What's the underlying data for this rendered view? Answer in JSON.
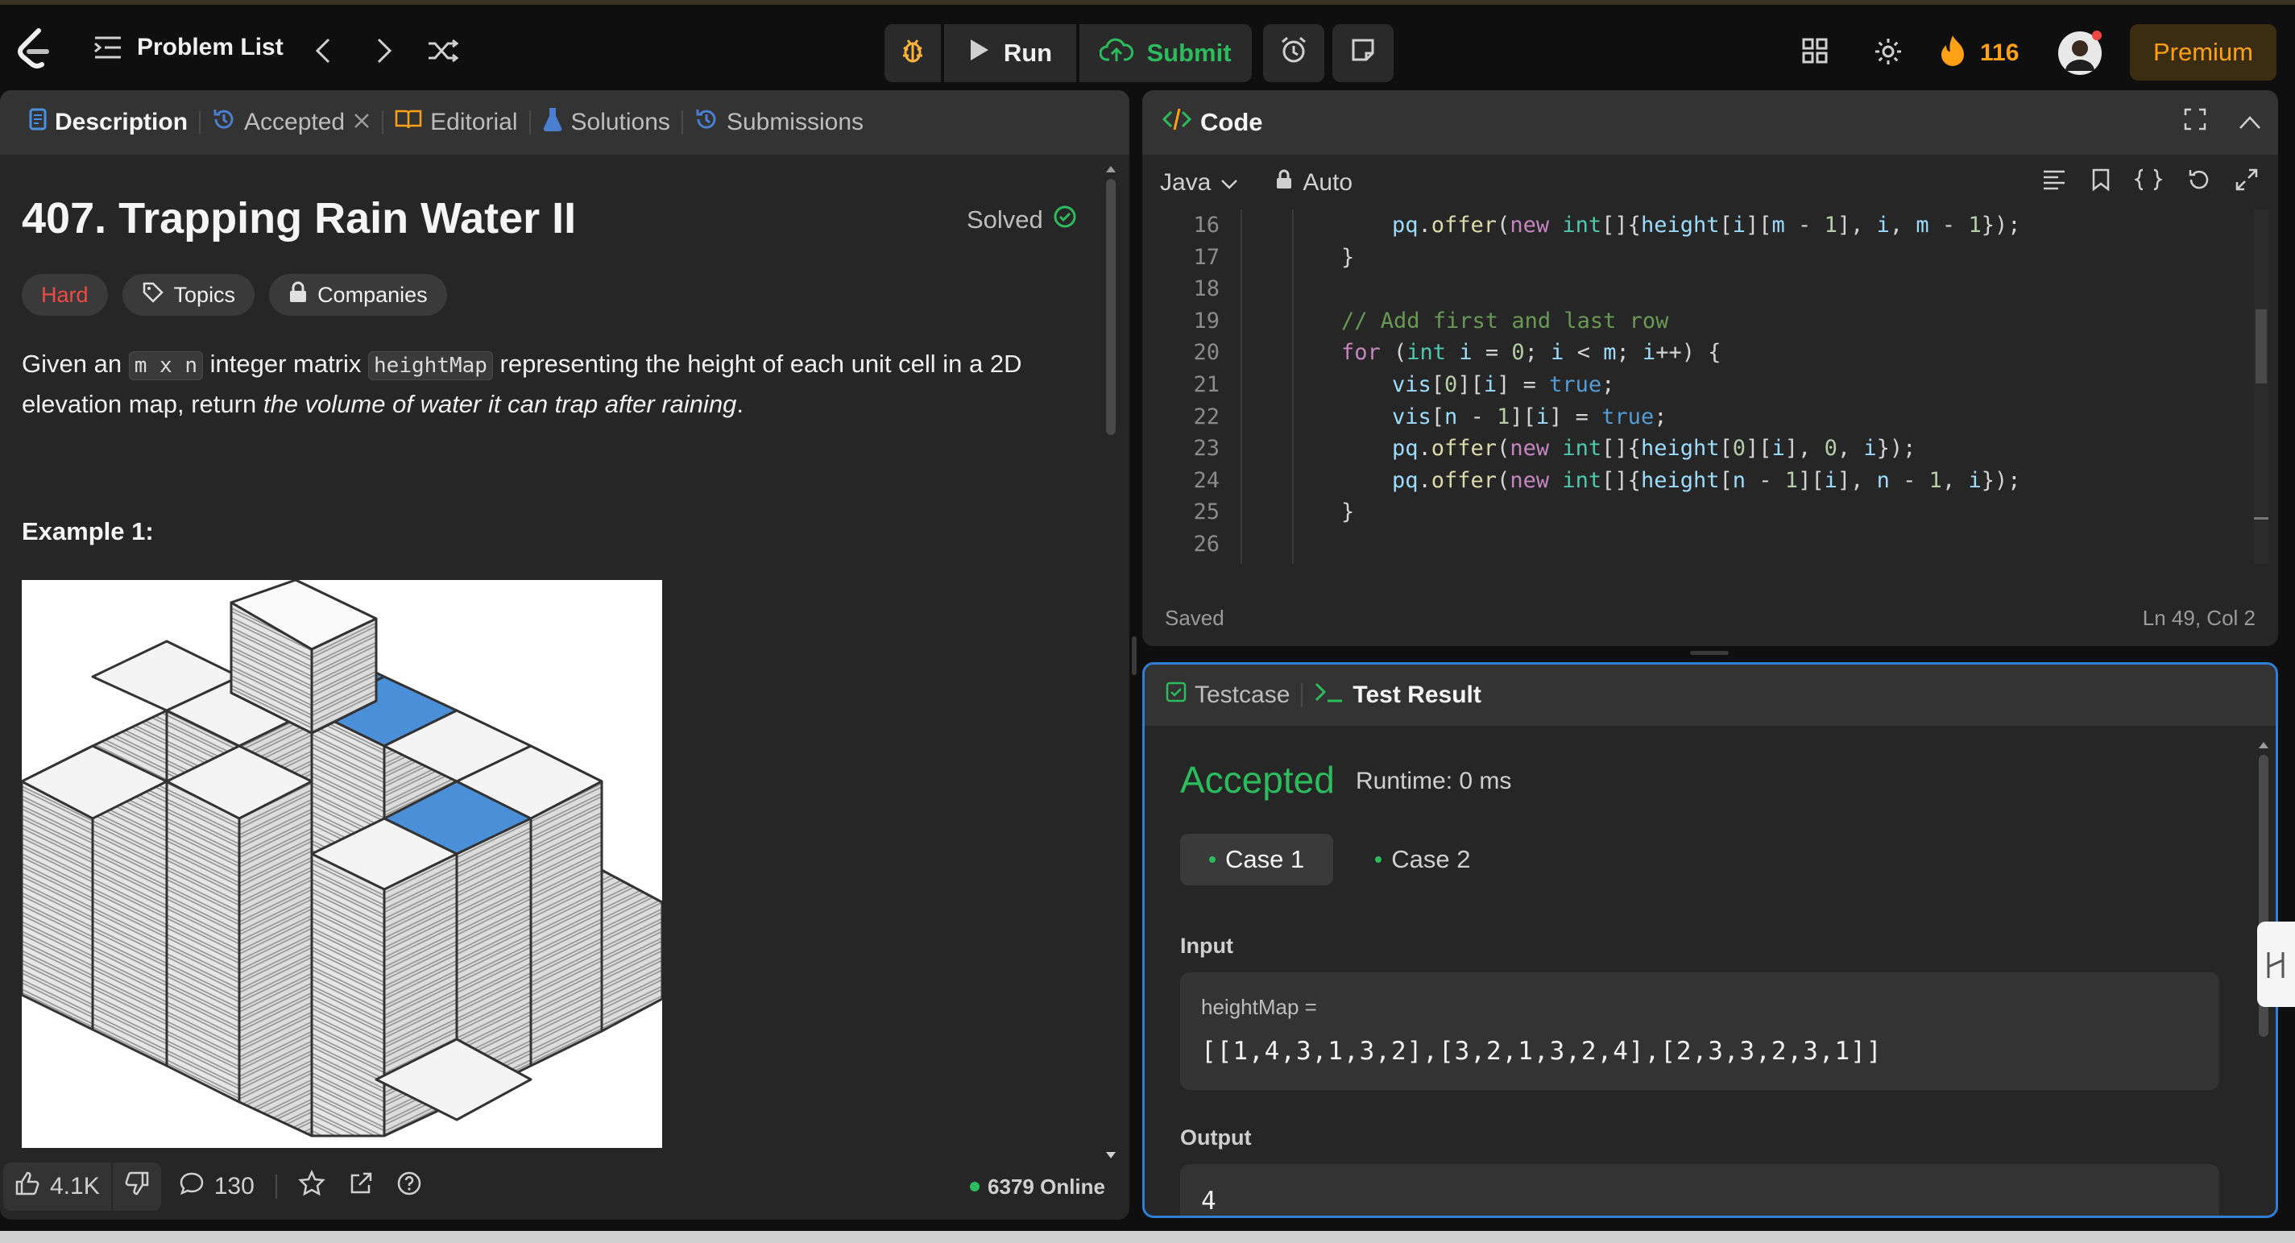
{
  "topbar": {
    "problem_list": "Problem List",
    "run": "Run",
    "submit": "Submit",
    "streak": "116",
    "premium": "Premium"
  },
  "left_tabs": [
    {
      "label": "Description"
    },
    {
      "label": "Accepted"
    },
    {
      "label": "Editorial"
    },
    {
      "label": "Solutions"
    },
    {
      "label": "Submissions"
    }
  ],
  "problem": {
    "title": "407. Trapping Rain Water II",
    "solved": "Solved",
    "difficulty": "Hard",
    "topics": "Topics",
    "companies": "Companies",
    "desc_1": "Given an",
    "code_1": "m x n",
    "desc_2": "integer matrix",
    "code_2": "heightMap",
    "desc_3": "representing the height of each unit cell in a 2D elevation map, return",
    "desc_em": "the volume of water it can trap after raining",
    "desc_end": ".",
    "example": "Example 1:"
  },
  "bottom": {
    "likes": "4.1K",
    "comments": "130",
    "online": "6379 Online"
  },
  "code": {
    "header": "Code",
    "language": "Java",
    "mode": "Auto",
    "status": "Saved",
    "cursor": "Ln 49, Col 2",
    "line_numbers": [
      "16",
      "17",
      "18",
      "19",
      "20",
      "21",
      "22",
      "23",
      "24",
      "25",
      "26"
    ]
  },
  "result": {
    "tab_testcase": "Testcase",
    "tab_result": "Test Result",
    "verdict": "Accepted",
    "runtime": "Runtime: 0 ms",
    "cases": [
      "Case 1",
      "Case 2"
    ],
    "input_label": "Input",
    "input_var": "heightMap =",
    "input_value": "[[1,4,3,1,3,2],[3,2,1,3,2,4],[2,3,3,2,3,1]]",
    "output_label": "Output",
    "output_value": "4"
  },
  "colors": {
    "accent_green": "#2cbb5d",
    "premium": "#ffa116",
    "hard": "#f04a44",
    "focus_border": "#2f7fd8"
  }
}
